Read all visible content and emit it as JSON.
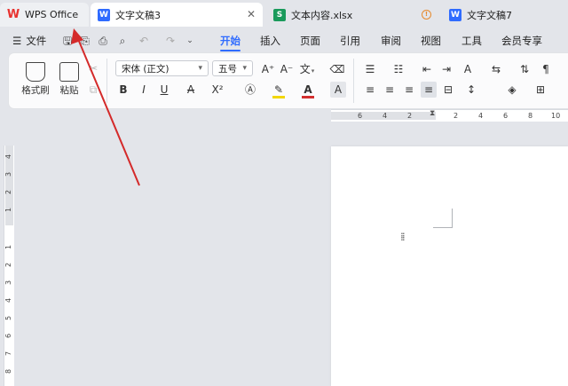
{
  "tabs": [
    {
      "id": "wps",
      "label": "WPS Office"
    },
    {
      "id": "doc3",
      "label": "文字文稿3"
    },
    {
      "id": "xlsx",
      "label": "文本内容.xlsx"
    },
    {
      "id": "doc7",
      "label": "文字文稿7"
    }
  ],
  "tab_icon_letters": {
    "doc3": "W",
    "xlsx": "S",
    "doc7": "W"
  },
  "close_glyph": "✕",
  "menu": {
    "file": "文件",
    "items": [
      "开始",
      "插入",
      "页面",
      "引用",
      "审阅",
      "视图",
      "工具",
      "会员专享"
    ],
    "active": "开始"
  },
  "ribbon": {
    "format_painter": "格式刷",
    "paste": "粘贴",
    "font_name": "宋体 (正文)",
    "font_size": "五号",
    "bold": "B",
    "italic": "I",
    "underline": "U",
    "superscript": "X²",
    "font_color_letter": "A",
    "highlight_color": "#f2d600",
    "font_color": "#d32f2f"
  },
  "hruler_ticks": [
    "6",
    "4",
    "2",
    "2",
    "4",
    "6",
    "8",
    "10"
  ],
  "vruler_ticks": [
    "4",
    "3",
    "2",
    "1",
    "1",
    "2",
    "3",
    "4",
    "5",
    "6",
    "7",
    "8"
  ],
  "colors": {
    "accent": "#2f6bff",
    "annotation": "#d42a2a",
    "wps_logo": "#e8322f"
  }
}
